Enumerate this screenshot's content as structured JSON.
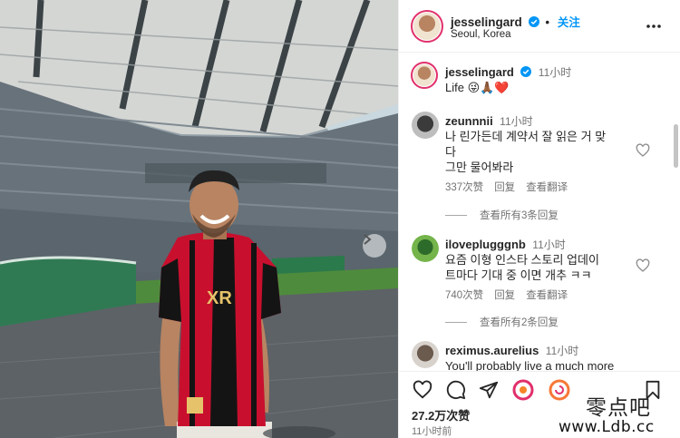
{
  "post": {
    "username": "jesselingard",
    "follow_label": "关注",
    "location": "Seoul, Korea",
    "caption_time": "11小时",
    "caption": "Life 😜🙏🏾❤️"
  },
  "comments": [
    {
      "username": "zeunnnii",
      "time": "11小时",
      "lines": [
        "나 린가든데 계약서 잘 읽은 거 맞",
        "다",
        "그만 물어봐라"
      ],
      "likes": "337次赞",
      "reply_label": "回复",
      "translate_label": "查看翻译",
      "view_replies": "查看所有3条回复"
    },
    {
      "username": "iloveplugggnb",
      "time": "11小时",
      "lines": [
        "요즘 이형 인스타 스토리 업데이",
        "트마다 기대 중 이면 개추 ㅋㅋ"
      ],
      "likes": "740次赞",
      "reply_label": "回复",
      "translate_label": "查看翻译",
      "view_replies": "查看所有2条回复"
    },
    {
      "username": "reximus.aurelius",
      "time": "11小时",
      "lines": [
        "You'll probably live a much more"
      ]
    }
  ],
  "footer": {
    "likes": "27.2万次赞",
    "posted": "11小时前"
  },
  "icons": {
    "header_avatar": "profile-photo",
    "verified": "verified-badge-icon",
    "more": "more-options-icon",
    "like": "heart-icon",
    "comment": "comment-bubble-icon",
    "share": "paper-plane-icon",
    "save": "bookmark-icon"
  },
  "colors": {
    "accent": "#0095f6",
    "verified": "#0095f6",
    "story_ring": "#e1306c",
    "jersey_red": "#c8102e",
    "jersey_black": "#141414"
  },
  "watermark": {
    "chinese": "零点吧",
    "url": "www.Ldb.cc"
  }
}
